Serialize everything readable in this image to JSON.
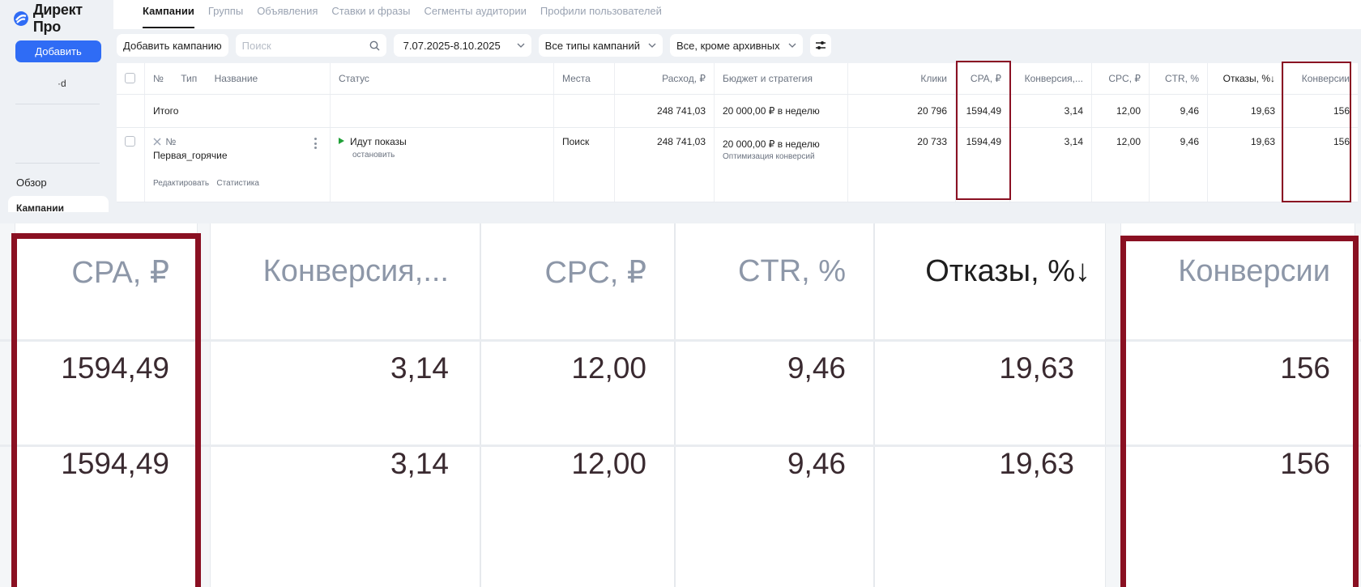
{
  "app": {
    "logo_text": "Директ Про",
    "add_button": "Добавить",
    "account": "·d"
  },
  "sidebar": {
    "overview": "Обзор",
    "campaigns": "Кампании"
  },
  "tabs": [
    {
      "label": "Кампании",
      "active": true
    },
    {
      "label": "Группы"
    },
    {
      "label": "Объявления"
    },
    {
      "label": "Ставки и фразы"
    },
    {
      "label": "Сегменты аудитории"
    },
    {
      "label": "Профили пользователей"
    }
  ],
  "toolbar": {
    "add_campaign": "Добавить кампанию",
    "search_placeholder": "Поиск",
    "date_range": "7.07.2025-8.10.2025",
    "campaign_types": "Все типы кампаний",
    "archive_filter": "Все, кроме архивных"
  },
  "table": {
    "headers": {
      "num": "№",
      "type": "Тип",
      "name": "Название",
      "status": "Статус",
      "places": "Места",
      "spend": "Расход, ₽",
      "budget": "Бюджет и стратегия",
      "clicks": "Клики",
      "cpa": "CPA, ₽",
      "conv_rate": "Конверсия,...",
      "cpc": "CPC, ₽",
      "ctr": "CTR, %",
      "bounce": "Отказы, %↓",
      "conversions": "Конверсии"
    },
    "total": {
      "label": "Итого",
      "spend": "248 741,03",
      "budget": "20 000,00 ₽ в неделю",
      "clicks": "20 796",
      "cpa": "1594,49",
      "conv_rate": "3,14",
      "cpc": "12,00",
      "ctr": "9,46",
      "bounce": "19,63",
      "conversions": "156"
    },
    "campaign": {
      "num": "№",
      "name": "Первая_горячие",
      "edit": "Редактировать",
      "stats": "Статистика",
      "status": "Идут показы",
      "status_action": "остановить",
      "places": "Поиск",
      "spend": "248 741,03",
      "budget": "20 000,00 ₽ в неделю",
      "strategy": "Оптимизация конверсий",
      "clicks": "20 733",
      "cpa": "1594,49",
      "conv_rate": "3,14",
      "cpc": "12,00",
      "ctr": "9,46",
      "bounce": "19,63",
      "conversions": "156"
    }
  },
  "colors": {
    "accent": "#2f6cf5",
    "highlight": "#8a1022",
    "status_active": "#21a038"
  }
}
